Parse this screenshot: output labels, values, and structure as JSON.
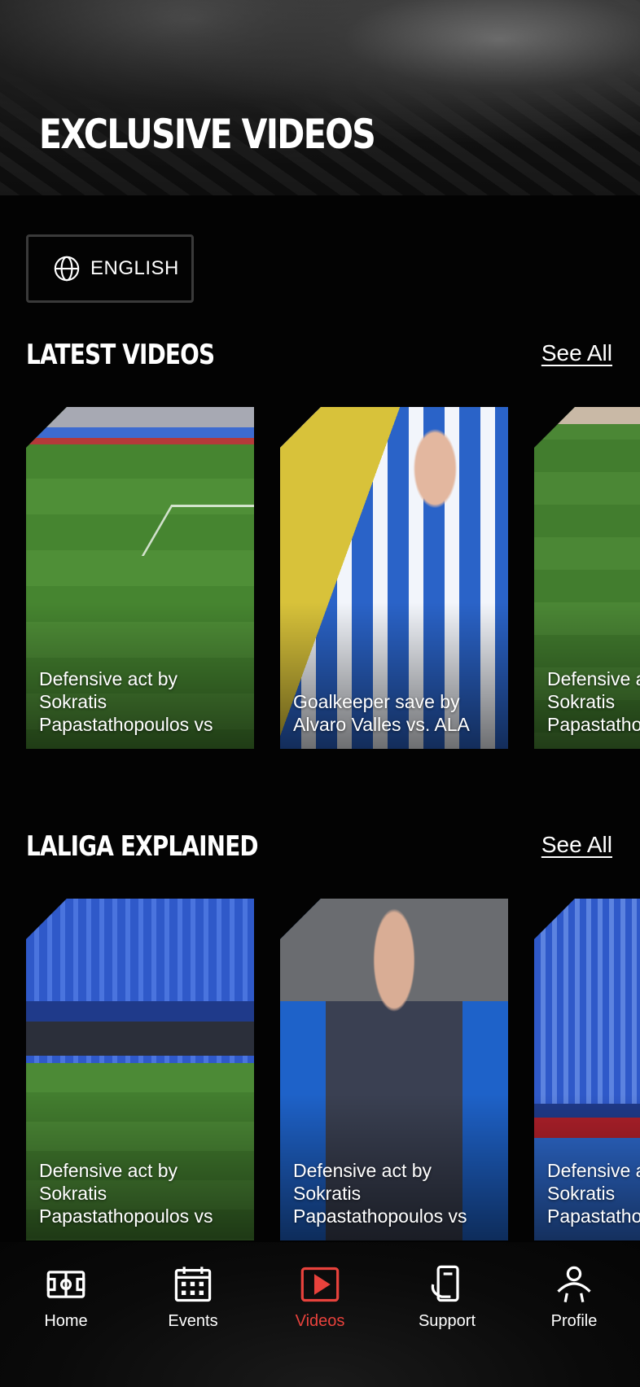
{
  "hero": {
    "title": "EXCLUSIVE VIDEOS"
  },
  "language": {
    "label": "ENGLISH",
    "icon": "globe-icon"
  },
  "sections": [
    {
      "title": "LATEST VIDEOS",
      "see_all": "See All",
      "cards": [
        {
          "caption": "Defensive act by Sokratis Papastathopoulos vs"
        },
        {
          "caption": "Goalkeeper save by Alvaro Valles vs. ALA"
        },
        {
          "caption": "Defensive act by Sokratis Papastathopoulos vs"
        }
      ]
    },
    {
      "title": "LALIGA EXPLAINED",
      "see_all": "See All",
      "cards": [
        {
          "caption": "Defensive act by Sokratis Papastathopoulos vs"
        },
        {
          "caption": "Defensive act by Sokratis Papastathopoulos vs"
        },
        {
          "caption": "Defensive act by Sokratis Papastathopoulos vs"
        }
      ]
    }
  ],
  "nav": {
    "active_color": "#e8423c",
    "items": [
      {
        "label": "Home",
        "icon": "stadium-icon"
      },
      {
        "label": "Events",
        "icon": "calendar-icon"
      },
      {
        "label": "Videos",
        "icon": "play-icon",
        "active": true
      },
      {
        "label": "Support",
        "icon": "support-icon"
      },
      {
        "label": "Profile",
        "icon": "profile-icon"
      }
    ]
  }
}
